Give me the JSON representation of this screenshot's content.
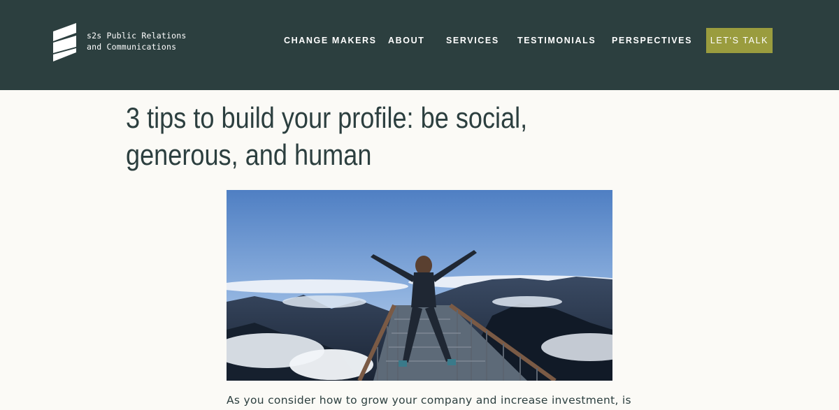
{
  "brand": {
    "line1": "s2s Public Relations",
    "line2": "and Communications"
  },
  "nav": {
    "items": [
      {
        "label": "CHANGE MAKERS"
      },
      {
        "label": "ABOUT"
      },
      {
        "label": "SERVICES"
      },
      {
        "label": "TESTIMONIALS"
      },
      {
        "label": "PERSPECTIVES"
      }
    ],
    "cta_label": "LET'S TALK"
  },
  "article": {
    "title": "3 tips to build your profile: be social, generous, and human",
    "intro": "As you consider how to grow your company and increase investment, is"
  },
  "colors": {
    "header_bg": "#2c3f3f",
    "cta_bg": "#9a9c3e",
    "page_bg": "#fbfaf6",
    "title_text": "#2c3f3f"
  },
  "icons": {
    "logo": "s2s-logo-icon",
    "hero": "hero-image"
  }
}
